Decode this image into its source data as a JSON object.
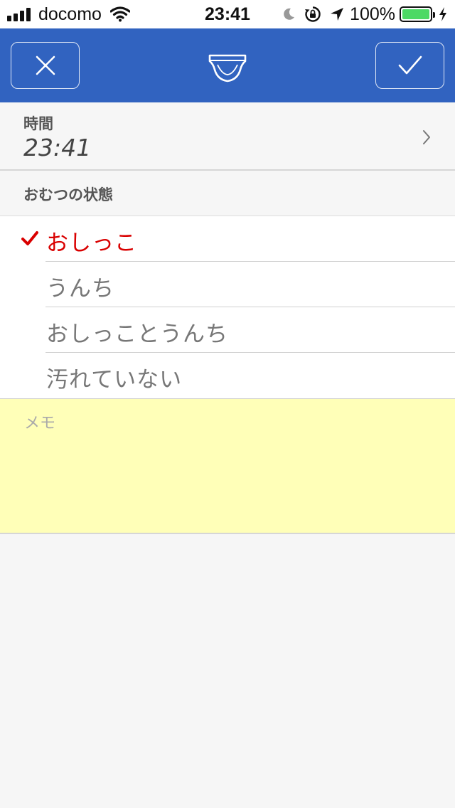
{
  "status_bar": {
    "carrier": "docomo",
    "time": "23:41",
    "battery_percent": "100%",
    "battery_level": 1.0,
    "battery_color": "#4cd964",
    "icons": [
      "signal-icon",
      "wifi-icon",
      "moon-icon",
      "rotation-lock-icon",
      "location-icon",
      "battery-icon",
      "charging-icon"
    ]
  },
  "header": {
    "background_color": "#3163c0",
    "cancel_icon": "close-icon",
    "logo_icon": "diaper-icon",
    "confirm_icon": "checkmark-icon"
  },
  "time_section": {
    "label": "時間",
    "value": "23:41",
    "chevron_icon": "chevron-right-icon"
  },
  "diaper_state": {
    "header": "おむつの状態",
    "options": [
      {
        "label": "おしっこ",
        "selected": true
      },
      {
        "label": "うんち",
        "selected": false
      },
      {
        "label": "おしっことうんち",
        "selected": false
      },
      {
        "label": "汚れていない",
        "selected": false
      }
    ],
    "selected_color": "#d90000"
  },
  "memo": {
    "placeholder": "メモ",
    "value": "",
    "background_color": "#ffffb8"
  }
}
